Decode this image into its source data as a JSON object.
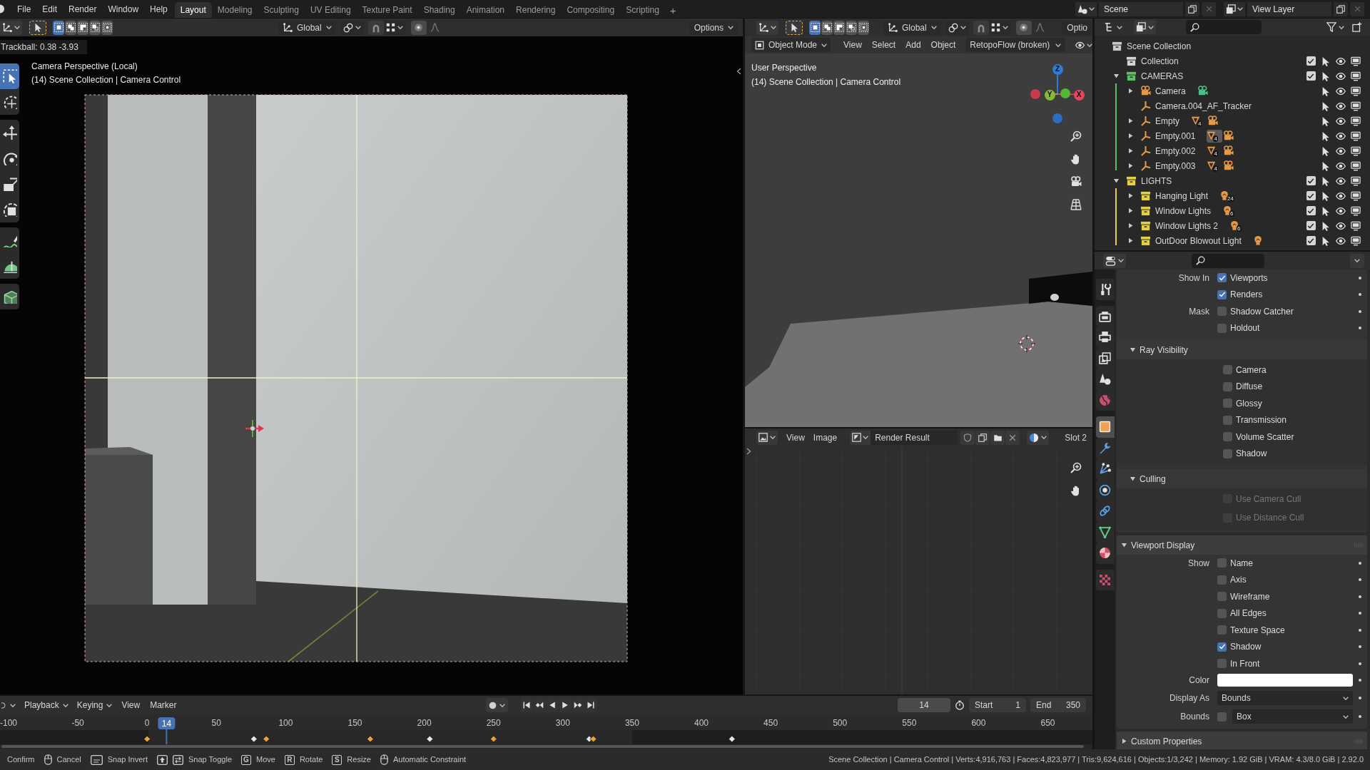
{
  "topbar": {
    "menus": [
      "File",
      "Edit",
      "Render",
      "Window",
      "Help"
    ],
    "workspaces": [
      {
        "label": "Layout",
        "selected": true
      },
      {
        "label": "Modeling",
        "selected": false
      },
      {
        "label": "Sculpting",
        "selected": false
      },
      {
        "label": "UV Editing",
        "selected": false
      },
      {
        "label": "Texture Paint",
        "selected": false
      },
      {
        "label": "Shading",
        "selected": false
      },
      {
        "label": "Animation",
        "selected": false
      },
      {
        "label": "Rendering",
        "selected": false
      },
      {
        "label": "Compositing",
        "selected": false
      },
      {
        "label": "Scripting",
        "selected": false
      }
    ],
    "add_workspace": "+",
    "scene": "Scene",
    "view_layer": "View Layer"
  },
  "main_viewport": {
    "header": {
      "select_modes": [
        {
          "selected": true
        },
        {
          "selected": false
        },
        {
          "selected": false
        },
        {
          "selected": false
        },
        {
          "selected": false
        }
      ],
      "orientation": "Global",
      "options": {
        "label": "Options",
        "caret": true
      }
    },
    "tool_groups": [
      {
        "tools": [
          {
            "kind": "select",
            "selected": true
          },
          {
            "kind": "cursor",
            "selected": false
          }
        ]
      },
      {
        "tools": [
          {
            "kind": "move",
            "selected": false
          },
          {
            "kind": "rotate",
            "selected": false
          },
          {
            "kind": "scale",
            "selected": false
          },
          {
            "kind": "transform",
            "selected": false
          }
        ]
      },
      {
        "tools": [
          {
            "kind": "annotate",
            "selected": false
          },
          {
            "kind": "measure",
            "selected": false
          }
        ]
      },
      {
        "tools": [
          {
            "kind": "add_cube",
            "selected": false
          }
        ]
      }
    ],
    "operator_info": "Trackball: 0.38 -3.93",
    "view_name": "Camera Perspective (Local)",
    "context": "(14) Scene Collection | Camera Control"
  },
  "side_viewport": {
    "header": {
      "select_modes": [
        {
          "selected": true
        },
        {
          "selected": false
        },
        {
          "selected": false
        },
        {
          "selected": false
        },
        {
          "selected": false
        }
      ],
      "orientation": "Global",
      "options": {
        "label": "Optio",
        "caret": false
      }
    },
    "tool_header": {
      "mode": "Object Mode",
      "menus": [
        "View",
        "Select",
        "Add",
        "Object"
      ],
      "addon": "RetopoFlow (broken)"
    },
    "view_name": "User Perspective",
    "context": "(14) Scene Collection | Camera Control",
    "gizmo": [
      {
        "kind": "z",
        "label": "Z"
      },
      {
        "kind": "y",
        "label": "Y"
      },
      {
        "kind": "x",
        "label": "X"
      }
    ]
  },
  "image_editor": {
    "menus": [
      "View",
      "Image"
    ],
    "image": "Render Result",
    "slot": "Slot 2"
  },
  "outliner": {
    "items": [
      {
        "name": "Scene Collection",
        "kind": "scene_collection",
        "children": [
          {
            "name": "Collection",
            "kind": "collection",
            "color": "#d4d4d4",
            "checked": true
          },
          {
            "name": "CAMERAS",
            "kind": "collection",
            "color": "#5cbf63",
            "checked": true,
            "expanded": true,
            "children": [
              {
                "name": "Camera",
                "kind": "camera",
                "expanded": false,
                "badges": [
                  {
                    "kind": "camera_data"
                  }
                ]
              },
              {
                "name": "Camera.004_AF_Tracker",
                "kind": "empty"
              },
              {
                "name": "Empty",
                "kind": "empty",
                "expanded": false,
                "badges": [
                  {
                    "kind": "constraint",
                    "count": "4",
                    "selected": false
                  },
                  {
                    "kind": "camera"
                  }
                ]
              },
              {
                "name": "Empty.001",
                "kind": "empty",
                "expanded": false,
                "badges": [
                  {
                    "kind": "constraint",
                    "count": "4",
                    "selected": true
                  },
                  {
                    "kind": "camera"
                  }
                ]
              },
              {
                "name": "Empty.002",
                "kind": "empty",
                "expanded": false,
                "badges": [
                  {
                    "kind": "constraint",
                    "count": "4",
                    "selected": false
                  },
                  {
                    "kind": "camera"
                  }
                ]
              },
              {
                "name": "Empty.003",
                "kind": "empty",
                "expanded": false,
                "badges": [
                  {
                    "kind": "constraint",
                    "count": "4",
                    "selected": false
                  },
                  {
                    "kind": "camera"
                  }
                ]
              }
            ]
          },
          {
            "name": "LIGHTS",
            "kind": "collection",
            "color": "#e3cf45",
            "checked": true,
            "expanded": true,
            "children": [
              {
                "name": "Hanging Light",
                "kind": "collection",
                "color": "#e3cf45",
                "checked": true,
                "expanded": false,
                "badges": [
                  {
                    "kind": "light",
                    "count": "24"
                  }
                ]
              },
              {
                "name": "Window Lights",
                "kind": "collection",
                "color": "#e3cf45",
                "checked": true,
                "expanded": false,
                "badges": [
                  {
                    "kind": "light",
                    "count": "6"
                  }
                ]
              },
              {
                "name": "Window Lights 2",
                "kind": "collection",
                "color": "#e3cf45",
                "checked": true,
                "expanded": false,
                "badges": [
                  {
                    "kind": "light",
                    "count": "6"
                  }
                ]
              },
              {
                "name": "OutDoor Blowout Light",
                "kind": "collection",
                "color": "#e3cf45",
                "checked": true,
                "expanded": false,
                "badges": [
                  {
                    "kind": "light"
                  }
                ]
              }
            ]
          }
        ]
      }
    ]
  },
  "properties": {
    "tabs": [
      {
        "kind": "tool",
        "selected": false
      },
      {
        "kind": "render",
        "selected": false
      },
      {
        "kind": "output",
        "selected": false
      },
      {
        "kind": "view_layer",
        "selected": false
      },
      {
        "kind": "scene",
        "selected": false
      },
      {
        "kind": "world",
        "selected": false
      },
      {
        "kind": "object",
        "selected": true
      },
      {
        "kind": "modifiers",
        "selected": false
      },
      {
        "kind": "particles",
        "selected": false
      },
      {
        "kind": "physics",
        "selected": false
      },
      {
        "kind": "constraints",
        "selected": false
      },
      {
        "kind": "data",
        "selected": false
      },
      {
        "kind": "material",
        "selected": false
      },
      {
        "kind": "texture",
        "selected": false
      }
    ],
    "panels": [
      {
        "rows": [
          {
            "kind": "checkbox",
            "label": "Show In",
            "text": "Viewports",
            "checked": true,
            "disabled": false,
            "animatable": true
          },
          {
            "kind": "checkbox",
            "text": "Renders",
            "checked": true,
            "disabled": false,
            "animatable": true
          },
          {
            "kind": "checkbox",
            "label": "Mask",
            "text": "Shadow Catcher",
            "checked": false,
            "disabled": false,
            "animatable": true
          },
          {
            "kind": "checkbox",
            "text": "Holdout",
            "checked": false,
            "disabled": false,
            "animatable": true
          }
        ],
        "subpanels": [
          {
            "title": "Ray Visibility",
            "expanded": true,
            "rows": [
              {
                "kind": "checkbox",
                "text": "Camera",
                "checked": false,
                "disabled": false,
                "animatable": false
              },
              {
                "kind": "checkbox",
                "text": "Diffuse",
                "checked": false,
                "disabled": false,
                "animatable": false
              },
              {
                "kind": "checkbox",
                "text": "Glossy",
                "checked": false,
                "disabled": false,
                "animatable": false
              },
              {
                "kind": "checkbox",
                "text": "Transmission",
                "checked": false,
                "disabled": false,
                "animatable": false
              },
              {
                "kind": "checkbox",
                "text": "Volume Scatter",
                "checked": false,
                "disabled": false,
                "animatable": false
              },
              {
                "kind": "checkbox",
                "text": "Shadow",
                "checked": false,
                "disabled": false,
                "animatable": false
              }
            ]
          },
          {
            "title": "Culling",
            "expanded": true,
            "rows": [
              {
                "kind": "checkbox",
                "text": "Use Camera Cull",
                "checked": false,
                "disabled": true,
                "animatable": false
              },
              {
                "kind": "checkbox",
                "text": "Use Distance Cull",
                "checked": false,
                "disabled": true,
                "animatable": false
              }
            ]
          }
        ]
      },
      {
        "title": "Viewport Display",
        "expanded": true,
        "rows": [
          {
            "kind": "checkbox",
            "label": "Show",
            "text": "Name",
            "checked": false,
            "disabled": false,
            "animatable": true
          },
          {
            "kind": "checkbox",
            "text": "Axis",
            "checked": false,
            "disabled": false,
            "animatable": true
          },
          {
            "kind": "checkbox",
            "text": "Wireframe",
            "checked": false,
            "disabled": false,
            "animatable": true
          },
          {
            "kind": "checkbox",
            "text": "All Edges",
            "checked": false,
            "disabled": false,
            "animatable": true
          },
          {
            "kind": "checkbox",
            "text": "Texture Space",
            "checked": false,
            "disabled": false,
            "animatable": true
          },
          {
            "kind": "checkbox",
            "text": "Shadow",
            "checked": true,
            "disabled": false,
            "animatable": true
          },
          {
            "kind": "checkbox",
            "text": "In Front",
            "checked": false,
            "disabled": false,
            "animatable": true
          },
          {
            "kind": "color",
            "label": "Color",
            "color": "#ffffff",
            "animatable": true
          },
          {
            "kind": "dropdown",
            "label": "Display As",
            "value": "Bounds",
            "animatable": true
          },
          {
            "kind": "checkbox_dropdown",
            "label": "Bounds",
            "checked": false,
            "value": "Box",
            "animatable": true
          }
        ]
      },
      {
        "title": "Custom Properties",
        "expanded": false
      }
    ]
  },
  "timeline": {
    "menus": [
      {
        "label": "Playback",
        "kind": "dropdown"
      },
      {
        "label": "Keying",
        "kind": "dropdown"
      },
      {
        "label": "View",
        "kind": "menu"
      },
      {
        "label": "Marker",
        "kind": "menu"
      }
    ],
    "current_frame": "14",
    "start_label": "Start",
    "start": "1",
    "end_label": "End",
    "end": "350",
    "ruler_labels": [
      "-100",
      "-50",
      "0",
      "50",
      "100",
      "150",
      "200",
      "250",
      "300",
      "350",
      "400",
      "450",
      "500",
      "550",
      "600",
      "650"
    ],
    "playhead": "14",
    "keyframes": [
      {
        "selected": true
      },
      {
        "selected": false
      },
      {
        "selected": true
      },
      {
        "selected": true
      },
      {
        "selected": false
      },
      {
        "selected": true
      },
      {
        "selected": false
      },
      {
        "selected": true
      },
      {
        "selected": false
      }
    ]
  },
  "status_bar": {
    "hints": [
      {
        "kind": "label",
        "text": "Confirm"
      },
      {
        "kind": "mouse"
      },
      {
        "kind": "label",
        "text": "Cancel"
      },
      {
        "kind": "ctrl_key"
      },
      {
        "kind": "label",
        "text": "Snap Invert"
      },
      {
        "kind": "shift_key"
      },
      {
        "kind": "tab_key"
      },
      {
        "kind": "label",
        "text": "Snap Toggle"
      },
      {
        "kind": "key",
        "text": "G"
      },
      {
        "kind": "label",
        "text": "Move"
      },
      {
        "kind": "key",
        "text": "R"
      },
      {
        "kind": "label",
        "text": "Rotate"
      },
      {
        "kind": "key",
        "text": "S"
      },
      {
        "kind": "label",
        "text": "Resize"
      },
      {
        "kind": "mouse"
      },
      {
        "kind": "label",
        "text": "Automatic Constraint"
      }
    ],
    "stats": "Scene Collection | Camera Control | Verts:4,916,763 | Faces:4,823,977 | Tris:9,624,616 | Objects:1/3,242 | Memory: 1.92 GiB | VRAM: 4.3/8.0 GiB | 2.92.0"
  }
}
